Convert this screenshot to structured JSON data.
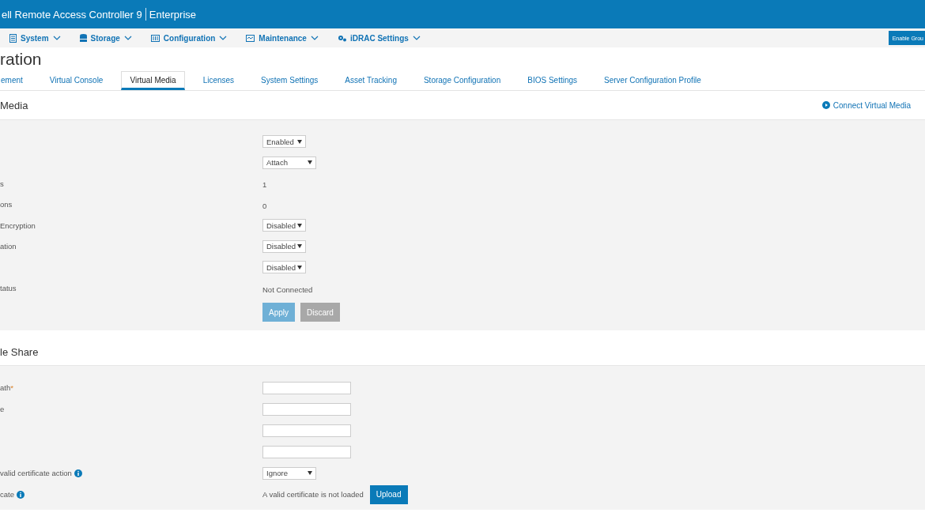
{
  "header": {
    "title": "ell Remote Access Controller 9",
    "edition": "Enterprise"
  },
  "nav": {
    "items": [
      {
        "label": "System"
      },
      {
        "label": "Storage"
      },
      {
        "label": "Configuration"
      },
      {
        "label": "Maintenance"
      },
      {
        "label": "iDRAC Settings"
      }
    ],
    "action": "Enable Grou"
  },
  "page_title": "ration",
  "tabs": [
    {
      "label": "ement",
      "selected": false
    },
    {
      "label": "Virtual Console",
      "selected": false
    },
    {
      "label": "Virtual Media",
      "selected": true
    },
    {
      "label": "Licenses",
      "selected": false
    },
    {
      "label": "System Settings",
      "selected": false
    },
    {
      "label": "Asset Tracking",
      "selected": false
    },
    {
      "label": "Storage Configuration",
      "selected": false
    },
    {
      "label": "BIOS Settings",
      "selected": false
    },
    {
      "label": "Server Configuration Profile",
      "selected": false
    }
  ],
  "sections": [
    {
      "title": "Media",
      "action": "Connect Virtual Media",
      "rows": [
        {
          "kind": "select",
          "value": "Enabled",
          "wide": false
        },
        {
          "kind": "select",
          "value": "Attach",
          "wide": true
        },
        {
          "kind": "text",
          "label": "s",
          "value": "1"
        },
        {
          "kind": "text",
          "label": "ons",
          "value": "0"
        },
        {
          "kind": "select",
          "label": "Encryption",
          "value": "Disabled",
          "wide": false
        },
        {
          "kind": "select",
          "label": "ation",
          "value": "Disabled",
          "wide": false
        },
        {
          "kind": "select",
          "value": "Disabled",
          "wide": false
        },
        {
          "kind": "text",
          "label": "tatus",
          "value": "Not Connected"
        },
        {
          "kind": "buttons",
          "buttons": [
            {
              "kind": "apply",
              "label": "Apply",
              "disabled": true
            },
            {
              "kind": "discard",
              "label": "Discard",
              "disabled": true
            }
          ]
        }
      ]
    },
    {
      "title": "le Share",
      "rows": [
        {
          "kind": "input",
          "label": "ath",
          "required_mark": "*"
        },
        {
          "kind": "input",
          "label": "e"
        },
        {
          "kind": "input"
        },
        {
          "kind": "input"
        },
        {
          "kind": "select",
          "label": "valid certificate action",
          "info": true,
          "value": "Ignore",
          "wide": true
        },
        {
          "kind": "upload",
          "label": "cate",
          "info": true,
          "value": "A valid certificate is not loaded",
          "button": "Upload"
        }
      ]
    }
  ]
}
